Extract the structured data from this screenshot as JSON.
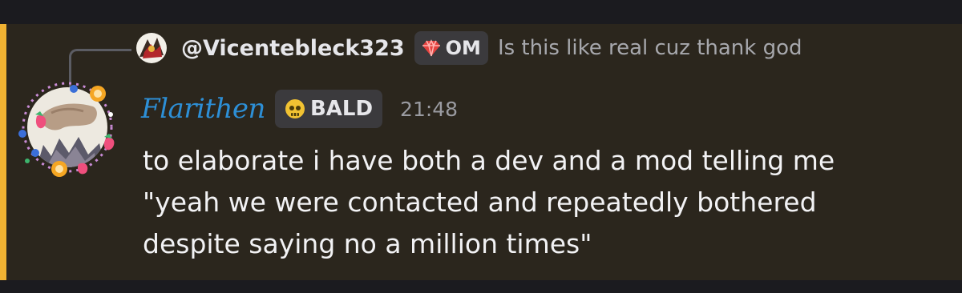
{
  "colors": {
    "accent_bar": "#f0b232",
    "author_name": "#2d8fd6",
    "message_bg": "#2b261d"
  },
  "reply": {
    "username": "@Vicentebleck323",
    "tag_icon": "gem-icon",
    "tag_label": "OM",
    "text": "Is this like real cuz thank god"
  },
  "message": {
    "author": "Flarithen",
    "tag_icon": "skull-icon",
    "tag_label": "BALD",
    "timestamp": "21:48",
    "lines": [
      "to elaborate i have both a dev and a mod telling me",
      "\"yeah we were contacted and repeatedly bothered",
      "despite saying no a million times\""
    ]
  }
}
